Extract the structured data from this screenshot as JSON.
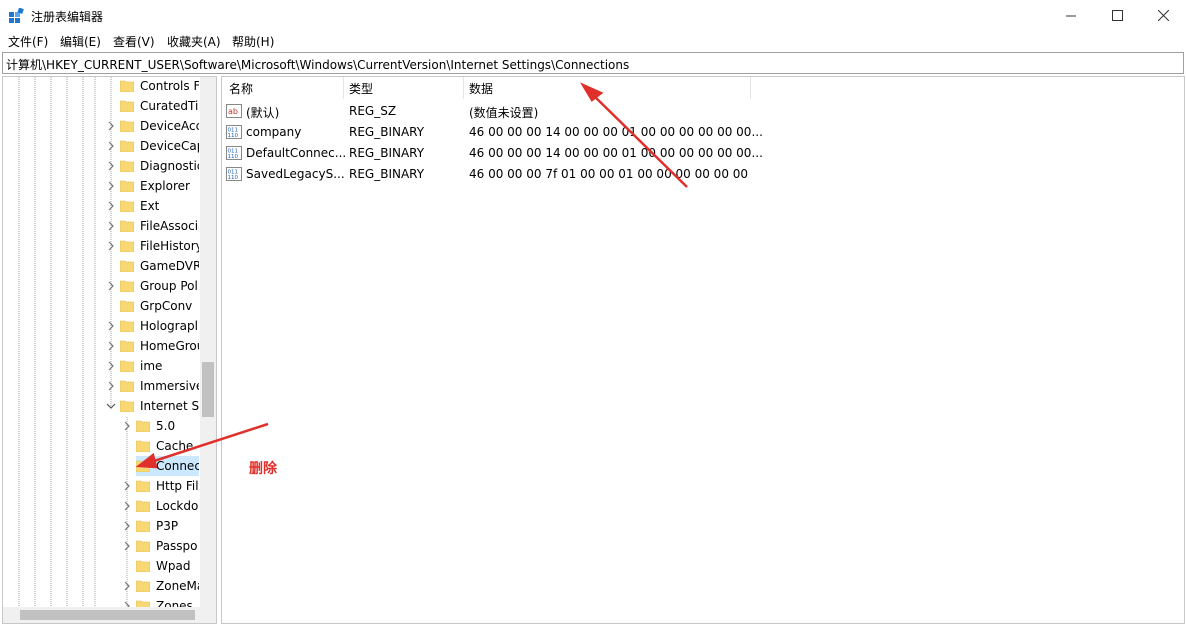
{
  "window": {
    "title": "注册表编辑器",
    "controls": {
      "minimize": "—",
      "maximize": "☐",
      "close": "✕"
    }
  },
  "menu": [
    "文件(F)",
    "编辑(E)",
    "查看(V)",
    "收藏夹(A)",
    "帮助(H)"
  ],
  "address": "计算机\\HKEY_CURRENT_USER\\Software\\Microsoft\\Windows\\CurrentVersion\\Internet Settings\\Connections",
  "tree": {
    "items": [
      {
        "label": "Controls F",
        "level": 1,
        "expander": false
      },
      {
        "label": "CuratedTil",
        "level": 1,
        "expander": false
      },
      {
        "label": "DeviceAcc",
        "level": 1,
        "expander": true
      },
      {
        "label": "DeviceCap",
        "level": 1,
        "expander": true
      },
      {
        "label": "Diagnostic",
        "level": 1,
        "expander": true
      },
      {
        "label": "Explorer",
        "level": 1,
        "expander": true
      },
      {
        "label": "Ext",
        "level": 1,
        "expander": true
      },
      {
        "label": "FileAssocia",
        "level": 1,
        "expander": true
      },
      {
        "label": "FileHistory",
        "level": 1,
        "expander": true
      },
      {
        "label": "GameDVR",
        "level": 1,
        "expander": false
      },
      {
        "label": "Group Pol",
        "level": 1,
        "expander": true
      },
      {
        "label": "GrpConv",
        "level": 1,
        "expander": false
      },
      {
        "label": "Holograpl",
        "level": 1,
        "expander": true
      },
      {
        "label": "HomeGrou",
        "level": 1,
        "expander": true
      },
      {
        "label": "ime",
        "level": 1,
        "expander": true
      },
      {
        "label": "Immersive",
        "level": 1,
        "expander": true
      },
      {
        "label": "Internet Se",
        "level": 1,
        "expander": "open"
      },
      {
        "label": "5.0",
        "level": 2,
        "expander": true
      },
      {
        "label": "Cache",
        "level": 2,
        "expander": false
      },
      {
        "label": "Connec",
        "level": 2,
        "expander": false,
        "selected": true
      },
      {
        "label": "Http Filt",
        "level": 2,
        "expander": true
      },
      {
        "label": "Lockdo",
        "level": 2,
        "expander": true
      },
      {
        "label": "P3P",
        "level": 2,
        "expander": true
      },
      {
        "label": "Passpo",
        "level": 2,
        "expander": true
      },
      {
        "label": "Wpad",
        "level": 2,
        "expander": false
      },
      {
        "label": "ZoneMa",
        "level": 2,
        "expander": true
      },
      {
        "label": "Zones",
        "level": 2,
        "expander": true
      }
    ]
  },
  "columns": {
    "name": "名称",
    "type": "类型",
    "data": "数据"
  },
  "values": [
    {
      "name": "(默认)",
      "type": "REG_SZ",
      "data": "(数值未设置)",
      "icon": "string-value-icon"
    },
    {
      "name": "company",
      "type": "REG_BINARY",
      "data": "46 00 00 00 14 00 00 00 01 00 00 00 00 00 00...",
      "icon": "binary-value-icon"
    },
    {
      "name": "DefaultConnec...",
      "type": "REG_BINARY",
      "data": "46 00 00 00 14 00 00 00 01 00 00 00 00 00 00...",
      "icon": "binary-value-icon"
    },
    {
      "name": "SavedLegacyS...",
      "type": "REG_BINARY",
      "data": "46 00 00 00 7f 01 00 00 01 00 00 00 00 00 00",
      "icon": "binary-value-icon"
    }
  ],
  "annotation": {
    "text": "删除",
    "color": "#e0302b"
  },
  "colors": {
    "folder": "#f8d775",
    "folder_dark": "#e0b94a",
    "selection": "#cce8ff",
    "accent": "#0078d7"
  }
}
